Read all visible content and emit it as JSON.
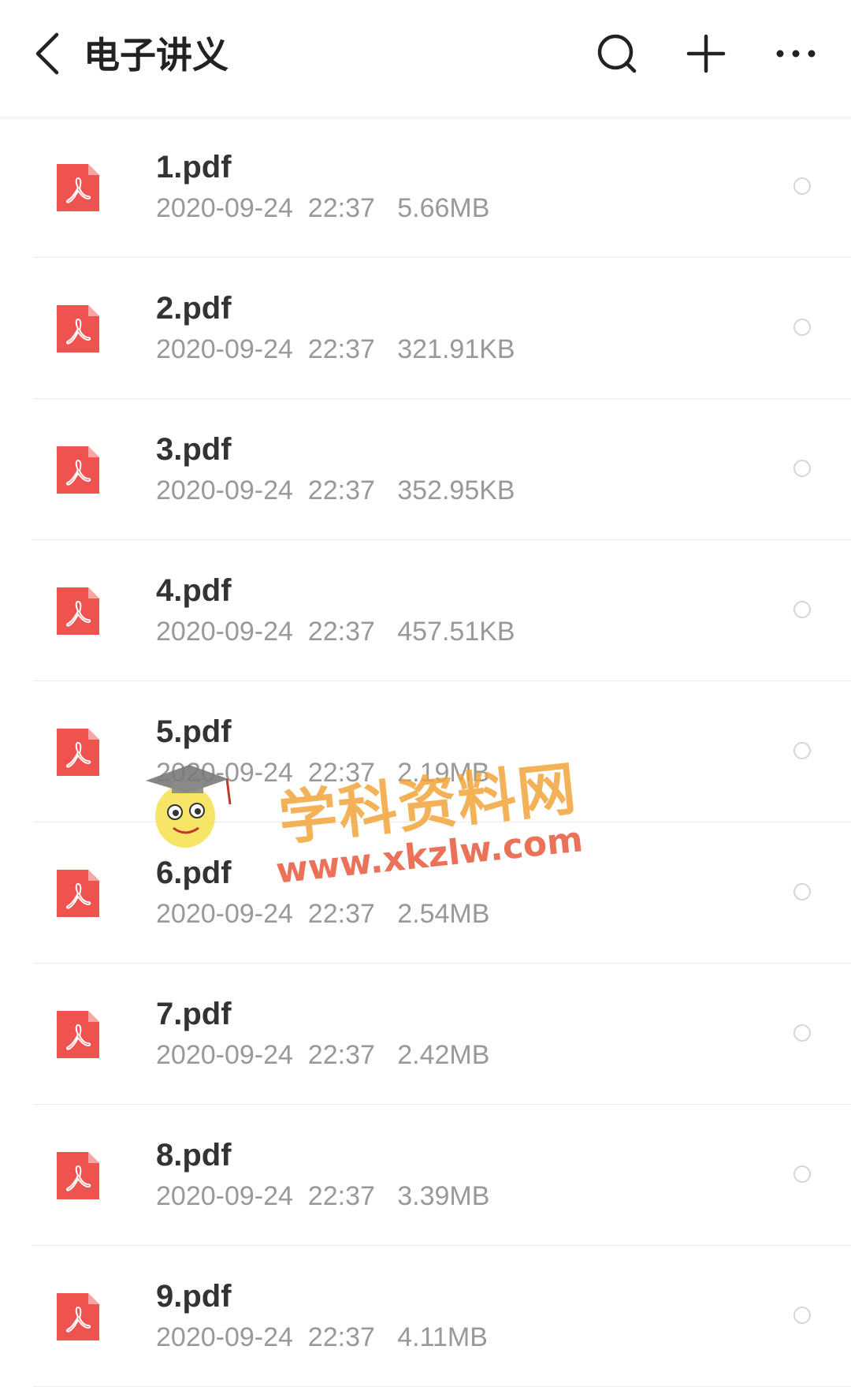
{
  "header": {
    "title": "电子讲义",
    "back_icon": "chevron-left-icon",
    "search_icon": "search-icon",
    "add_icon": "plus-icon",
    "more_icon": "more-horizontal-icon"
  },
  "colors": {
    "pdf_icon": "#ef5350",
    "title_text": "#222222",
    "meta_text": "#999999",
    "divider": "#ececec"
  },
  "files": [
    {
      "name": "1.pdf",
      "date": "2020-09-24",
      "time": "22:37",
      "size": "5.66MB"
    },
    {
      "name": "2.pdf",
      "date": "2020-09-24",
      "time": "22:37",
      "size": "321.91KB"
    },
    {
      "name": "3.pdf",
      "date": "2020-09-24",
      "time": "22:37",
      "size": "352.95KB"
    },
    {
      "name": "4.pdf",
      "date": "2020-09-24",
      "time": "22:37",
      "size": "457.51KB"
    },
    {
      "name": "5.pdf",
      "date": "2020-09-24",
      "time": "22:37",
      "size": "2.19MB"
    },
    {
      "name": "6.pdf",
      "date": "2020-09-24",
      "time": "22:37",
      "size": "2.54MB"
    },
    {
      "name": "7.pdf",
      "date": "2020-09-24",
      "time": "22:37",
      "size": "2.42MB"
    },
    {
      "name": "8.pdf",
      "date": "2020-09-24",
      "time": "22:37",
      "size": "3.39MB"
    },
    {
      "name": "9.pdf",
      "date": "2020-09-24",
      "time": "22:37",
      "size": "4.11MB"
    }
  ],
  "watermark": {
    "text_cn": "学科资料网",
    "url": "www.xkzlw.com"
  }
}
